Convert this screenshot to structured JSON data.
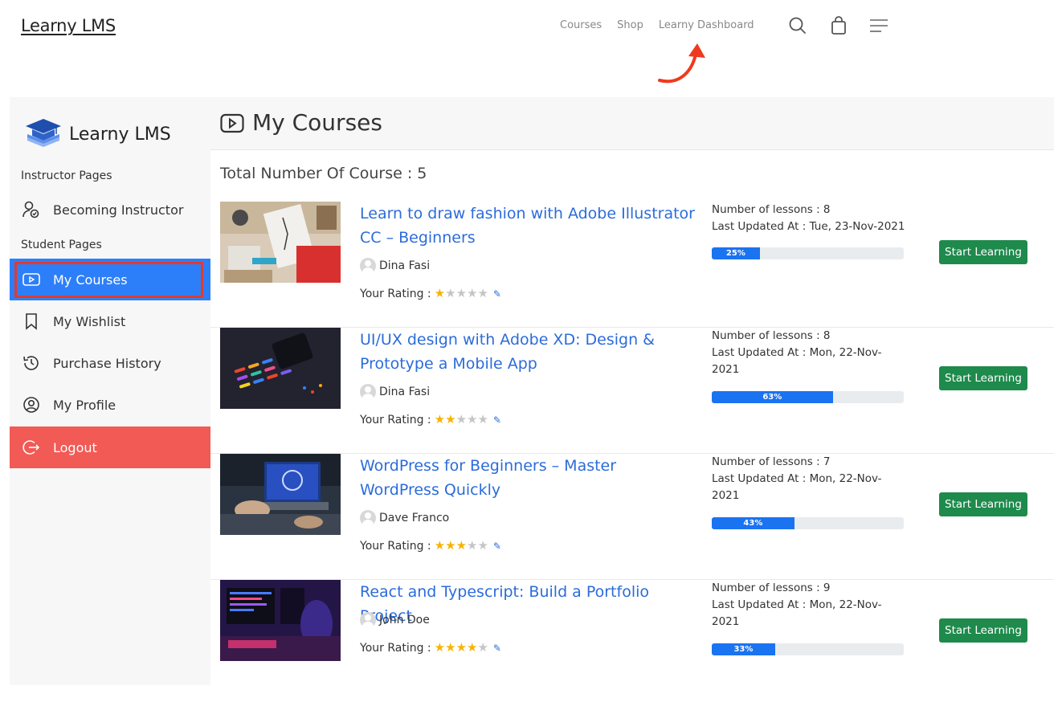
{
  "site": {
    "brand": "Learny LMS",
    "nav": [
      "Courses",
      "Shop",
      "Learny Dashboard"
    ]
  },
  "sidebar": {
    "brand": "Learny LMS",
    "instructor_section": "Instructor Pages",
    "student_section": "Student Pages",
    "items": [
      {
        "label": "Becoming Instructor",
        "icon": "user-check-icon"
      },
      {
        "label": "My Courses",
        "icon": "play-box-icon"
      },
      {
        "label": "My Wishlist",
        "icon": "bookmark-icon"
      },
      {
        "label": "Purchase History",
        "icon": "history-icon"
      },
      {
        "label": "My Profile",
        "icon": "user-circle-icon"
      },
      {
        "label": "Logout",
        "icon": "logout-icon"
      }
    ]
  },
  "main": {
    "title": "My Courses",
    "total": "Total Number Of Course : 5",
    "rating_label": "Your Rating :",
    "button_label": "Start Learning",
    "courses": [
      {
        "title": "Learn to draw fashion with Adobe Illustrator CC – Beginners",
        "author": "Dina Fasi",
        "rating": 1,
        "lessons": "Number of lessons : 8",
        "updated": "Last Updated At : Tue, 23-Nov-2021",
        "progress": 25,
        "progress_label": "25%"
      },
      {
        "title": "UI/UX design with Adobe XD: Design & Prototype a Mobile App",
        "author": "Dina Fasi",
        "rating": 2,
        "lessons": "Number of lessons : 8",
        "updated": "Last Updated At : Mon, 22-Nov-2021",
        "progress": 63,
        "progress_label": "63%"
      },
      {
        "title": "WordPress for Beginners – Master WordPress Quickly",
        "author": "Dave Franco",
        "rating": 3,
        "lessons": "Number of lessons : 7",
        "updated": "Last Updated At : Mon, 22-Nov-2021",
        "progress": 43,
        "progress_label": "43%"
      },
      {
        "title": "React and Typescript: Build a Portfolio Project",
        "author": "John Doe",
        "rating": 4,
        "lessons": "Number of lessons : 9",
        "updated": "Last Updated At : Mon, 22-Nov-2021",
        "progress": 33,
        "progress_label": "33%"
      }
    ]
  },
  "colors": {
    "accent_blue": "#2d7ff9",
    "highlight_red": "#e23a2c",
    "logout_red": "#f15a55",
    "button_green": "#1e8a4c",
    "link_blue": "#2b6cdb",
    "star": "#f5b400"
  }
}
